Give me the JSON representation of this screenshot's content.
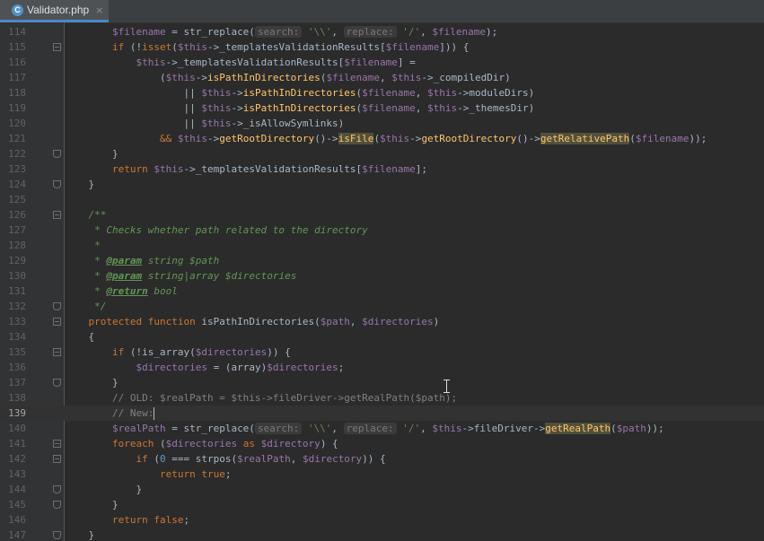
{
  "tab": {
    "icon_letter": "C",
    "title": "Validator.php",
    "close_glyph": "×"
  },
  "colors": {
    "background": "#2b2b2b",
    "gutter": "#313335",
    "tab_accent": "#4a88c7",
    "keyword": "#cc7832",
    "variable": "#9876aa",
    "string": "#6a8759",
    "function": "#ffc66d",
    "doc_comment": "#629755"
  },
  "editor": {
    "current_line": 139,
    "lines": [
      {
        "n": 114,
        "fold": "",
        "tokens": [
          [
            "        ",
            ""
          ],
          [
            "$filename",
            "var"
          ],
          [
            " = str_replace(",
            ""
          ],
          [
            "search:",
            "hint"
          ],
          [
            " ",
            ""
          ],
          [
            "'\\\\'",
            "str"
          ],
          [
            ", ",
            ""
          ],
          [
            "replace:",
            "hint"
          ],
          [
            " ",
            ""
          ],
          [
            "'/'",
            "str"
          ],
          [
            ", ",
            ""
          ],
          [
            "$filename",
            "var"
          ],
          [
            ");",
            ""
          ]
        ]
      },
      {
        "n": 115,
        "fold": "open",
        "tokens": [
          [
            "        ",
            ""
          ],
          [
            "if",
            "kw"
          ],
          [
            " (!",
            ""
          ],
          [
            "isset",
            "kw"
          ],
          [
            "(",
            ""
          ],
          [
            "$this",
            "var"
          ],
          [
            "->_templatesValidationResults[",
            ""
          ],
          [
            "$filename",
            "var"
          ],
          [
            "])) {",
            ""
          ]
        ]
      },
      {
        "n": 116,
        "fold": "",
        "tokens": [
          [
            "            ",
            ""
          ],
          [
            "$this",
            "var"
          ],
          [
            "->_templatesValidationResults[",
            ""
          ],
          [
            "$filename",
            "var"
          ],
          [
            "] =",
            ""
          ]
        ]
      },
      {
        "n": 117,
        "fold": "",
        "tokens": [
          [
            "                (",
            ""
          ],
          [
            "$this",
            "var"
          ],
          [
            "->",
            ""
          ],
          [
            "isPathInDirectories",
            "fn"
          ],
          [
            "(",
            ""
          ],
          [
            "$filename",
            "var"
          ],
          [
            ", ",
            ""
          ],
          [
            "$this",
            "var"
          ],
          [
            "->_compiledDir)",
            ""
          ]
        ]
      },
      {
        "n": 118,
        "fold": "",
        "tokens": [
          [
            "                    || ",
            ""
          ],
          [
            "$this",
            "var"
          ],
          [
            "->",
            ""
          ],
          [
            "isPathInDirectories",
            "fn"
          ],
          [
            "(",
            ""
          ],
          [
            "$filename",
            "var"
          ],
          [
            ", ",
            ""
          ],
          [
            "$this",
            "var"
          ],
          [
            "->moduleDirs)",
            ""
          ]
        ]
      },
      {
        "n": 119,
        "fold": "",
        "tokens": [
          [
            "                    || ",
            ""
          ],
          [
            "$this",
            "var"
          ],
          [
            "->",
            ""
          ],
          [
            "isPathInDirectories",
            "fn"
          ],
          [
            "(",
            ""
          ],
          [
            "$filename",
            "var"
          ],
          [
            ", ",
            ""
          ],
          [
            "$this",
            "var"
          ],
          [
            "->_themesDir)",
            ""
          ]
        ]
      },
      {
        "n": 120,
        "fold": "",
        "tokens": [
          [
            "                    || ",
            ""
          ],
          [
            "$this",
            "var"
          ],
          [
            "->_isAllowSymlinks)",
            ""
          ]
        ]
      },
      {
        "n": 121,
        "fold": "",
        "tokens": [
          [
            "                ",
            ""
          ],
          [
            "&&",
            "kw"
          ],
          [
            " ",
            ""
          ],
          [
            "$this",
            "var"
          ],
          [
            "->",
            ""
          ],
          [
            "getRootDirectory",
            "fn"
          ],
          [
            "()->",
            ""
          ],
          [
            "isFile",
            "hl"
          ],
          [
            "(",
            ""
          ],
          [
            "$this",
            "var"
          ],
          [
            "->",
            ""
          ],
          [
            "getRootDirectory",
            "fn"
          ],
          [
            "()->",
            ""
          ],
          [
            "getRelativePath",
            "hl"
          ],
          [
            "(",
            ""
          ],
          [
            "$filename",
            "var"
          ],
          [
            "));",
            ""
          ]
        ]
      },
      {
        "n": 122,
        "fold": "end",
        "tokens": [
          [
            "        }",
            ""
          ]
        ]
      },
      {
        "n": 123,
        "fold": "",
        "tokens": [
          [
            "        ",
            ""
          ],
          [
            "return",
            "kw"
          ],
          [
            " ",
            ""
          ],
          [
            "$this",
            "var"
          ],
          [
            "->_templatesValidationResults[",
            ""
          ],
          [
            "$filename",
            "var"
          ],
          [
            "];",
            ""
          ]
        ]
      },
      {
        "n": 124,
        "fold": "end",
        "tokens": [
          [
            "    }",
            ""
          ]
        ]
      },
      {
        "n": 125,
        "fold": "",
        "tokens": []
      },
      {
        "n": 126,
        "fold": "open",
        "tokens": [
          [
            "    ",
            ""
          ],
          [
            "/**",
            "doc"
          ]
        ]
      },
      {
        "n": 127,
        "fold": "",
        "tokens": [
          [
            "     ",
            ""
          ],
          [
            "* Checks whether path related to the directory",
            "doc"
          ]
        ]
      },
      {
        "n": 128,
        "fold": "",
        "tokens": [
          [
            "     ",
            ""
          ],
          [
            "*",
            "doc"
          ]
        ]
      },
      {
        "n": 129,
        "fold": "",
        "tokens": [
          [
            "     ",
            ""
          ],
          [
            "* ",
            "doc"
          ],
          [
            "@param",
            "tag"
          ],
          [
            " string $path",
            "doc"
          ]
        ]
      },
      {
        "n": 130,
        "fold": "",
        "tokens": [
          [
            "     ",
            ""
          ],
          [
            "* ",
            "doc"
          ],
          [
            "@param",
            "tag"
          ],
          [
            " string|array $directories",
            "doc"
          ]
        ]
      },
      {
        "n": 131,
        "fold": "",
        "tokens": [
          [
            "     ",
            ""
          ],
          [
            "* ",
            "doc"
          ],
          [
            "@return",
            "tag"
          ],
          [
            " bool",
            "doc"
          ]
        ]
      },
      {
        "n": 132,
        "fold": "end",
        "tokens": [
          [
            "     ",
            ""
          ],
          [
            "*/",
            "doc"
          ]
        ]
      },
      {
        "n": 133,
        "fold": "open",
        "tokens": [
          [
            "    ",
            ""
          ],
          [
            "protected",
            "kw"
          ],
          [
            " ",
            ""
          ],
          [
            "function",
            "kw"
          ],
          [
            " isPathInDirectories(",
            ""
          ],
          [
            "$path",
            "var"
          ],
          [
            ", ",
            ""
          ],
          [
            "$directories",
            "var"
          ],
          [
            ")",
            ""
          ]
        ]
      },
      {
        "n": 134,
        "fold": "",
        "tokens": [
          [
            "    {",
            ""
          ]
        ]
      },
      {
        "n": 135,
        "fold": "open",
        "tokens": [
          [
            "        ",
            ""
          ],
          [
            "if",
            "kw"
          ],
          [
            " (!is_array(",
            ""
          ],
          [
            "$directories",
            "var"
          ],
          [
            ")) {",
            ""
          ]
        ]
      },
      {
        "n": 136,
        "fold": "",
        "tokens": [
          [
            "            ",
            ""
          ],
          [
            "$directories",
            "var"
          ],
          [
            " = (array)",
            ""
          ],
          [
            "$directories",
            "var"
          ],
          [
            ";",
            ""
          ]
        ]
      },
      {
        "n": 137,
        "fold": "end",
        "tokens": [
          [
            "        }",
            ""
          ]
        ]
      },
      {
        "n": 138,
        "fold": "",
        "tokens": [
          [
            "        ",
            ""
          ],
          [
            "// OLD: $realPath = $this->fileDriver->getRealPath($path);",
            "cm"
          ]
        ]
      },
      {
        "n": 139,
        "fold": "",
        "tokens": [
          [
            "        ",
            ""
          ],
          [
            "// New:",
            "cm"
          ]
        ]
      },
      {
        "n": 140,
        "fold": "",
        "tokens": [
          [
            "        ",
            ""
          ],
          [
            "$realPath",
            "var"
          ],
          [
            " = str_replace(",
            ""
          ],
          [
            "search:",
            "hint"
          ],
          [
            " ",
            ""
          ],
          [
            "'\\\\'",
            "str"
          ],
          [
            ", ",
            ""
          ],
          [
            "replace:",
            "hint"
          ],
          [
            " ",
            ""
          ],
          [
            "'/'",
            "str"
          ],
          [
            ", ",
            ""
          ],
          [
            "$this",
            "var"
          ],
          [
            "->fileDriver->",
            ""
          ],
          [
            "getRealPath",
            "hl"
          ],
          [
            "(",
            ""
          ],
          [
            "$path",
            "var"
          ],
          [
            "));",
            ""
          ]
        ]
      },
      {
        "n": 141,
        "fold": "open",
        "tokens": [
          [
            "        ",
            ""
          ],
          [
            "foreach",
            "kw"
          ],
          [
            " (",
            ""
          ],
          [
            "$directories",
            "var"
          ],
          [
            " ",
            ""
          ],
          [
            "as",
            "kw"
          ],
          [
            " ",
            ""
          ],
          [
            "$directory",
            "var"
          ],
          [
            ") {",
            ""
          ]
        ]
      },
      {
        "n": 142,
        "fold": "open",
        "tokens": [
          [
            "            ",
            ""
          ],
          [
            "if",
            "kw"
          ],
          [
            " (",
            ""
          ],
          [
            "0",
            "num"
          ],
          [
            " === strpos(",
            ""
          ],
          [
            "$realPath",
            "var"
          ],
          [
            ", ",
            ""
          ],
          [
            "$directory",
            "var"
          ],
          [
            ")) {",
            ""
          ]
        ]
      },
      {
        "n": 143,
        "fold": "",
        "tokens": [
          [
            "                ",
            ""
          ],
          [
            "return",
            "kw"
          ],
          [
            " ",
            ""
          ],
          [
            "true",
            "kw"
          ],
          [
            ";",
            ""
          ]
        ]
      },
      {
        "n": 144,
        "fold": "end",
        "tokens": [
          [
            "            }",
            ""
          ]
        ]
      },
      {
        "n": 145,
        "fold": "end",
        "tokens": [
          [
            "        }",
            ""
          ]
        ]
      },
      {
        "n": 146,
        "fold": "",
        "tokens": [
          [
            "        ",
            ""
          ],
          [
            "return",
            "kw"
          ],
          [
            " ",
            ""
          ],
          [
            "false",
            "kw"
          ],
          [
            ";",
            ""
          ]
        ]
      },
      {
        "n": 147,
        "fold": "end",
        "tokens": [
          [
            "    }",
            ""
          ]
        ]
      }
    ]
  }
}
